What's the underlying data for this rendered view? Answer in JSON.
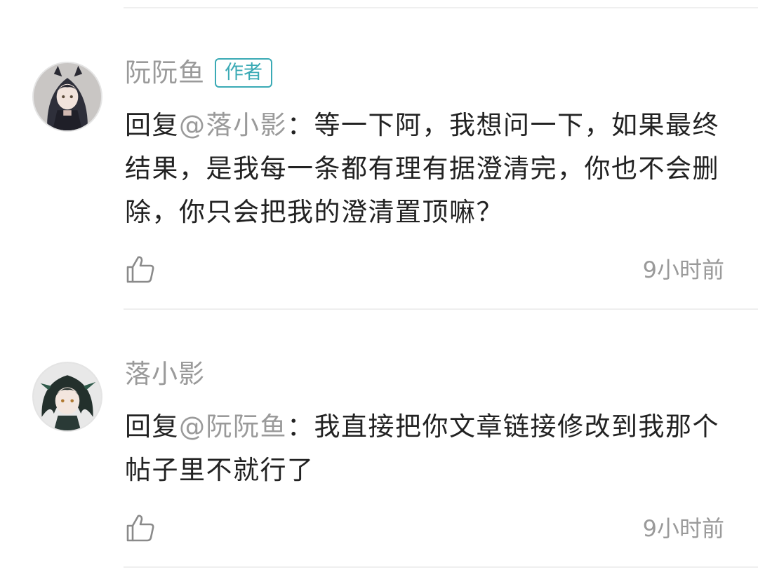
{
  "comments": [
    {
      "username": "阮阮鱼",
      "badge": "作者",
      "reply_prefix": "回复",
      "mention": "@落小影",
      "colon": "：",
      "text": "等一下阿，我想问一下，如果最终结果，是我每一条都有理有据澄清完，你也不会删除，你只会把我的澄清置顶嘛？",
      "time": "9小时前",
      "like_icon": "thumbs-up-icon",
      "avatar_icon": "dark-haired-character-avatar"
    },
    {
      "username": "落小影",
      "reply_prefix": "回复",
      "mention": "@阮阮鱼",
      "colon": "：",
      "text": "我直接把你文章链接修改到我那个帖子里不就行了",
      "time": "9小时前",
      "like_icon": "thumbs-up-icon",
      "avatar_icon": "green-haired-character-avatar"
    }
  ],
  "colors": {
    "badge_accent": "#3aaab5",
    "secondary_text": "#9a9a9a",
    "primary_text": "#222222",
    "divider": "#efefef"
  }
}
